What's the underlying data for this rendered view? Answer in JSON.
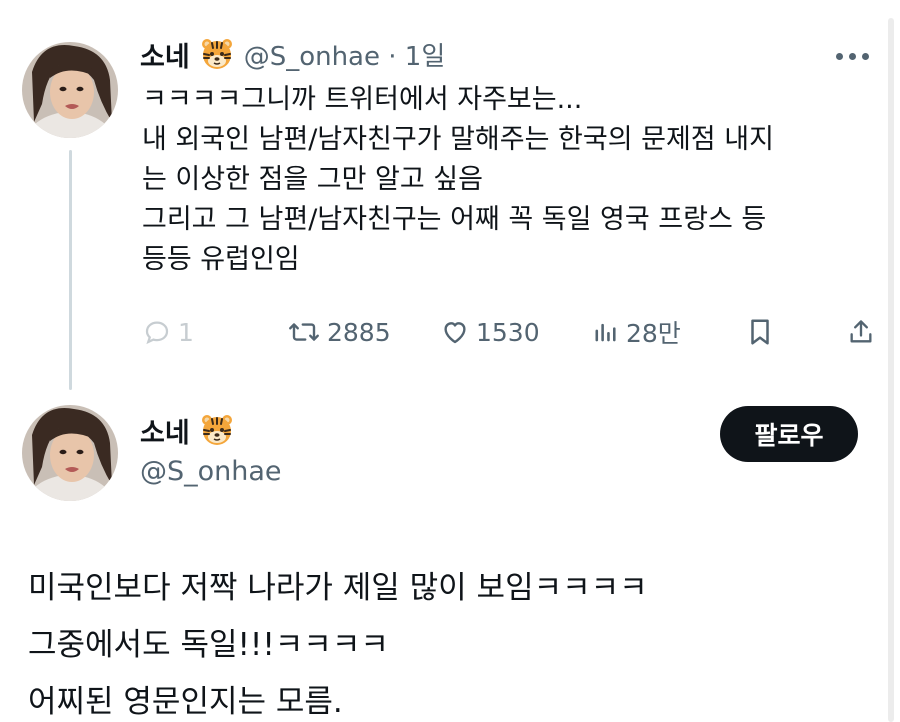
{
  "tweet1": {
    "display_name": "소네",
    "name_emoji": "tiger-face-emoji",
    "handle_meta": "@S_onhae · 1일",
    "text_lines": [
      "ㅋㅋㅋㅋ그니까 트위터에서 자주보는...",
      "내 외국인 남편/남자친구가 말해주는 한국의 문제점 내지",
      "는 이상한 점을 그만 알고 싶음",
      "그리고 그 남편/남자친구는 어째 꼭 독일 영국 프랑스 등",
      "등등 유럽인임"
    ],
    "actions": {
      "replies": "1",
      "retweets": "2885",
      "likes": "1530",
      "views": "28만"
    },
    "icons": {
      "more": "more-icon",
      "reply": "reply-icon",
      "retweet": "retweet-icon",
      "like": "heart-icon",
      "views": "views-icon",
      "bookmark": "bookmark-icon",
      "share": "share-icon"
    }
  },
  "tweet2": {
    "display_name": "소네",
    "name_emoji": "tiger-face-emoji",
    "handle": "@S_onhae",
    "follow_label": "팔로우",
    "text_lines": [
      "미국인보다 저짝 나라가 제일 많이 보임ㅋㅋㅋㅋ",
      "그중에서도 독일!!!ㅋㅋㅋㅋ",
      "어찌된 영문인지는 모름."
    ]
  },
  "colors": {
    "text": "#0f1419",
    "muted": "#536471",
    "thread_line": "#cfd9de",
    "follow_bg": "#0f1419",
    "follow_text": "#ffffff"
  }
}
